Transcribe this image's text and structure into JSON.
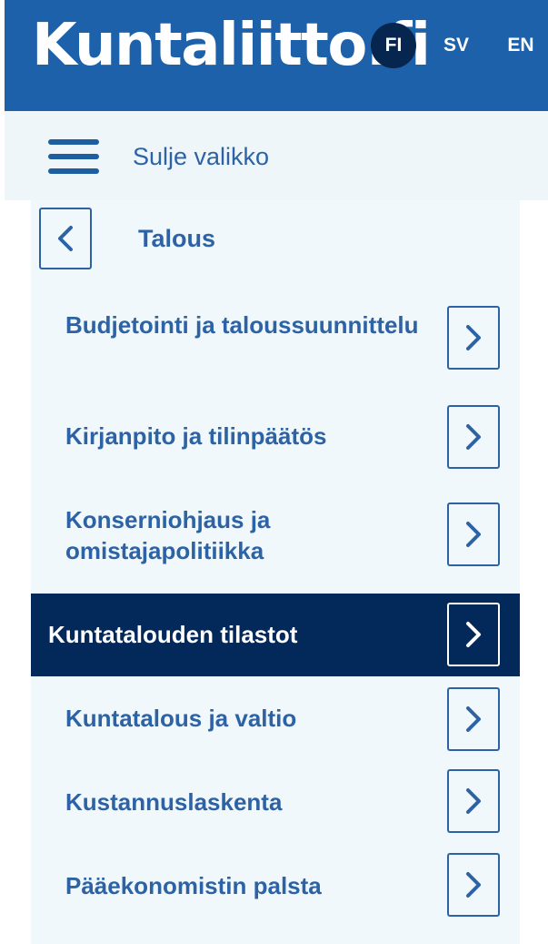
{
  "header": {
    "logo": "Kuntaliitto.fi",
    "languages": [
      {
        "code": "FI",
        "active": true
      },
      {
        "code": "SV",
        "active": false
      },
      {
        "code": "EN",
        "active": false
      }
    ]
  },
  "menu": {
    "close_label": "Sulje valikko"
  },
  "section": {
    "title": "Talous"
  },
  "items": [
    {
      "label": "Budjetointi ja taloussuunnittelu",
      "active": false
    },
    {
      "label": "Kirjanpito ja tilinpäätös",
      "active": false
    },
    {
      "label": "Konserniohjaus ja omistajapolitiikka",
      "active": false
    },
    {
      "label": "Kuntatalouden tilastot",
      "active": true
    },
    {
      "label": "Kuntatalous ja valtio",
      "active": false
    },
    {
      "label": "Kustannuslaskenta",
      "active": false
    },
    {
      "label": "Pääekonomistin palsta",
      "active": false
    }
  ],
  "colors": {
    "brand_blue": "#1c61a9",
    "navy": "#03295b",
    "link_blue": "#2d63a5",
    "panel_bg": "#f0f8fc"
  },
  "icons": {
    "menu": "hamburger-icon",
    "back": "chevron-left-icon",
    "forward": "chevron-right-icon"
  }
}
